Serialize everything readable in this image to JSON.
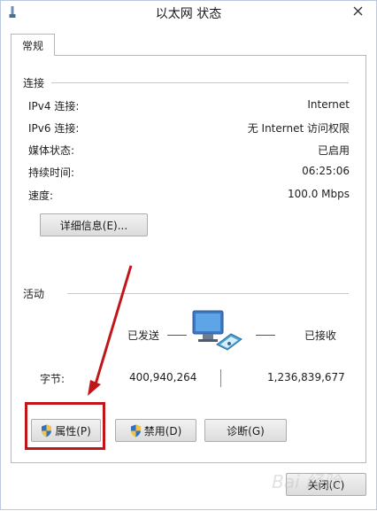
{
  "window": {
    "title": "以太网 状态"
  },
  "tabs": [
    {
      "label": "常规"
    }
  ],
  "connection": {
    "section_label": "连接",
    "rows": [
      {
        "label": "IPv4 连接:",
        "value": "Internet"
      },
      {
        "label": "IPv6 连接:",
        "value": "无 Internet 访问权限"
      },
      {
        "label": "媒体状态:",
        "value": "已启用"
      },
      {
        "label": "持续时间:",
        "value": "06:25:06"
      },
      {
        "label": "速度:",
        "value": "100.0 Mbps"
      }
    ],
    "details_button": "详细信息(E)..."
  },
  "activity": {
    "section_label": "活动",
    "sent_label": "已发送",
    "received_label": "已接收",
    "bytes_label": "字节:",
    "bytes_sent": "400,940,264",
    "bytes_received": "1,236,839,677"
  },
  "buttons": {
    "properties": "属性(P)",
    "disable": "禁用(D)",
    "diagnose": "诊断(G)",
    "close": "关闭(C)"
  },
  "watermark": "Bai 经验",
  "colors": {
    "annotation": "#c0161a",
    "window_border": "#b9c8de",
    "shield_blue": "#2f6fc9",
    "shield_yellow": "#f2c53d"
  },
  "icons": {
    "app": "network-icon",
    "network_activity": "network-computers-icon",
    "shield": "uac-shield-icon",
    "close": "close-icon"
  }
}
